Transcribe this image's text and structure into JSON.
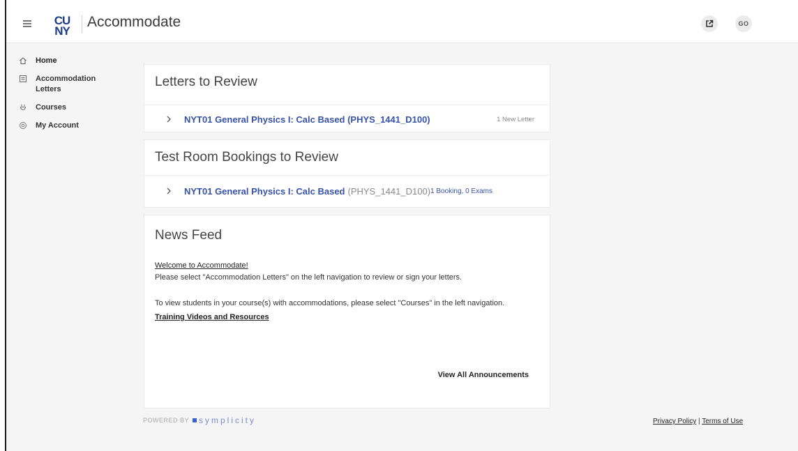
{
  "header": {
    "logo_line1": "CU",
    "logo_line2": "NY",
    "app_title": "Accommodate",
    "avatar_initials": "GO"
  },
  "sidebar": {
    "items": [
      {
        "label": "Home",
        "icon": "home-icon"
      },
      {
        "label": "Accommodation Letters",
        "icon": "letters-icon"
      },
      {
        "label": "Courses",
        "icon": "courses-icon"
      },
      {
        "label": "My Account",
        "icon": "account-icon"
      }
    ]
  },
  "letters_card": {
    "title": "Letters to Review",
    "row": {
      "course": "NYT01 General Physics I: Calc Based (PHYS_1441_D100)",
      "meta": "1 New Letter"
    }
  },
  "bookings_card": {
    "title": "Test Room Bookings to Review",
    "row": {
      "course": "NYT01 General Physics I: Calc Based",
      "course_code": "(PHYS_1441_D100)",
      "meta": "1 Booking, 0 Exams"
    }
  },
  "news_card": {
    "title": "News Feed",
    "welcome_link": "Welcome to Accommodate!",
    "line1": "Please select \"Accommodation Letters\" on the left navigation to review or sign your letters.",
    "line2": "To view students in your course(s) with accommodations, please select \"Courses\" in the left navigation.",
    "training_link": "Training Videos and Resources",
    "view_all": "View All Announcements"
  },
  "footer": {
    "powered_by": "POWERED BY",
    "brand": "symplicity",
    "privacy": "Privacy Policy",
    "separator": "|",
    "terms": "Terms of Use"
  },
  "colors": {
    "brand_blue": "#1b3c8c",
    "link_blue": "#3553a8"
  }
}
